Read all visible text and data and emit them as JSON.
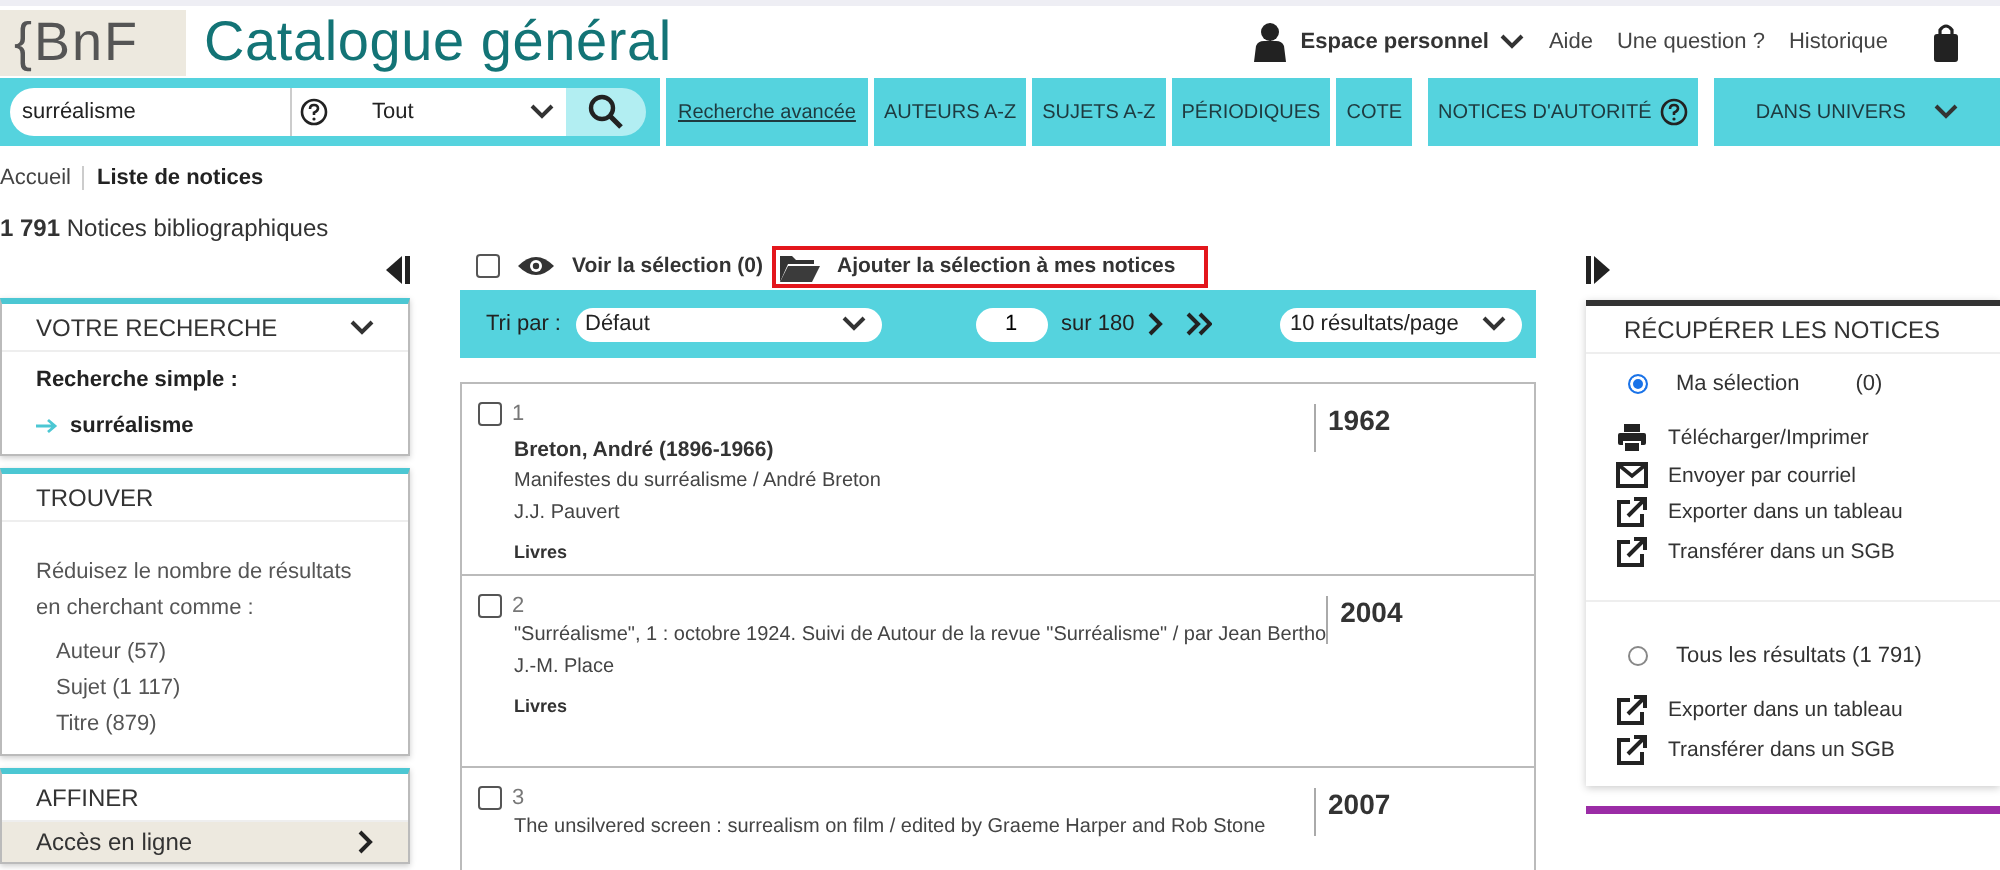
{
  "header": {
    "logo": "{BnF",
    "title": "Catalogue général",
    "user_menu": "Espace personnel",
    "links": [
      "Aide",
      "Une question ?",
      "Historique"
    ]
  },
  "search": {
    "value": "surréalisme",
    "scope": "Tout"
  },
  "nav": [
    {
      "label": "Recherche avancée",
      "kind": "link"
    },
    {
      "label": "AUTEURS A-Z",
      "kind": "plain"
    },
    {
      "label": "SUJETS A-Z",
      "kind": "plain"
    },
    {
      "label": "PÉRIODIQUES",
      "kind": "plain"
    },
    {
      "label": "COTE",
      "kind": "plain"
    },
    {
      "label": "NOTICES D'AUTORITÉ",
      "kind": "help"
    },
    {
      "label": "DANS UNIVERS",
      "kind": "dropdown"
    }
  ],
  "breadcrumb": [
    {
      "label": "Accueil",
      "current": false
    },
    {
      "label": "Liste de notices",
      "current": true
    }
  ],
  "result_count": "**1 791** Notices bibliographiques",
  "search_panel": {
    "title": "VOTRE RECHERCHE",
    "type_label": "Recherche simple :",
    "term": "surréalisme"
  },
  "find_panel": {
    "title": "TROUVER",
    "text": "Réduisez le nombre de résultats en cherchant comme :",
    "options": [
      "Auteur (57)",
      "Sujet (1 117)",
      "Titre (879)"
    ]
  },
  "refine_panel": {
    "title": "AFFINER",
    "items": [
      "Accès en ligne"
    ]
  },
  "toolbar": {
    "select_all_checked": false,
    "view_selection": "Voir la sélection (0)",
    "add_selection": "Ajouter la sélection à mes notices",
    "add_highlighted": true
  },
  "sort_bar": {
    "label": "Tri par :",
    "sort": "Défaut",
    "page": "1",
    "pages": "sur 180",
    "per_page": "10 résultats/page"
  },
  "results": [
    {
      "number": "1",
      "checked": false,
      "author": "Breton, André (1896-1966)",
      "title": "Manifestes du surréalisme / André Breton",
      "publisher": "J.J. Pauvert",
      "type": "Livres",
      "year": "1962"
    },
    {
      "number": "2",
      "checked": false,
      "title": "\"Surréalisme\", 1 : octobre 1924. Suivi de Autour de la revue \"Surréalisme\" / par Jean Bertho",
      "publisher": "J.-M. Place",
      "type": "Livres",
      "year": "2004"
    },
    {
      "number": "3",
      "checked": false,
      "title": "The unsilvered screen : surrealism on film / edited by Graeme Harper and Rob Stone",
      "year": "2007"
    }
  ],
  "export_panel": {
    "title": "RÉCUPÉRER LES NOTICES",
    "options": [
      {
        "label": "Ma sélection",
        "count": "(0)",
        "selected": true,
        "actions": [
          {
            "label": "Télécharger/Imprimer",
            "kind": "print"
          },
          {
            "label": "Envoyer par courriel",
            "kind": "mail"
          },
          {
            "label": "Exporter dans un tableau",
            "kind": "export"
          },
          {
            "label": "Transférer dans un SGB",
            "kind": "export"
          }
        ]
      },
      {
        "label": "Tous les résultats (1 791)",
        "selected": false,
        "actions": [
          {
            "label": "Exporter dans un tableau",
            "kind": "export"
          },
          {
            "label": "Transférer dans un SGB",
            "kind": "export"
          }
        ]
      }
    ]
  }
}
